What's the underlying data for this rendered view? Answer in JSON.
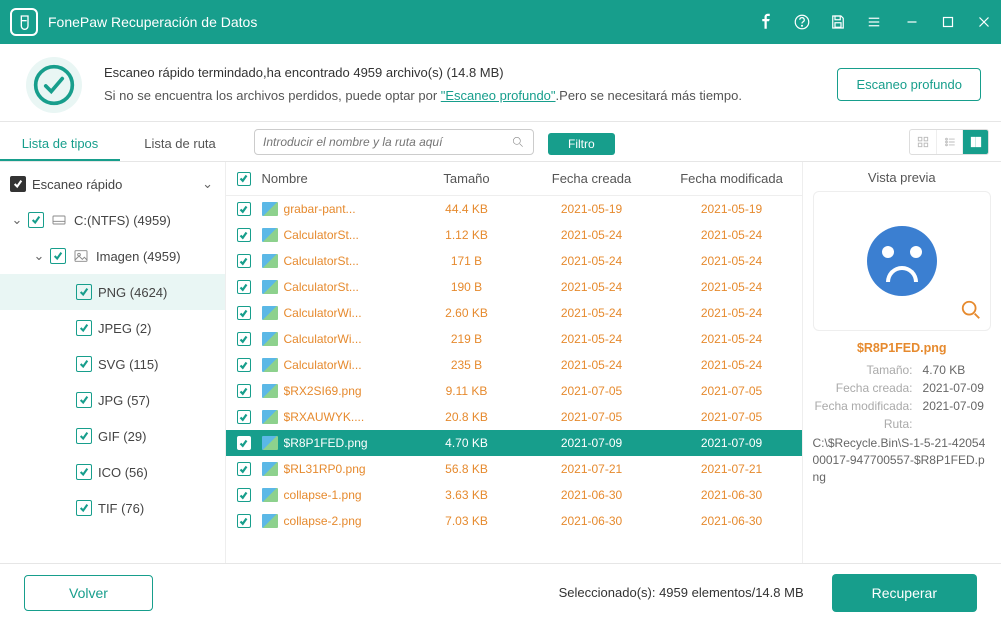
{
  "app": {
    "title": "FonePaw Recuperación de Datos"
  },
  "status": {
    "line1": "Escaneo rápido termindado,ha encontrado 4959 archivo(s) (14.8 MB)",
    "line2a": "Si no se encuentra los archivos perdidos, puede optar por ",
    "deep_link_label": "\"Escaneo profundo\"",
    "line2b": ".Pero se necesitará más tiempo.",
    "deep_btn": "Escaneo profundo"
  },
  "toolbar": {
    "tabs": {
      "types": "Lista de tipos",
      "paths": "Lista de ruta"
    },
    "search_placeholder": "Introducir el nombre y la ruta aquí",
    "filter_label": "Filtro"
  },
  "tree": {
    "header": "Escaneo rápido",
    "drive": "C:(NTFS) (4959)",
    "image_group": "Imagen (4959)",
    "types": [
      {
        "label": "PNG (4624)",
        "selected": true
      },
      {
        "label": "JPEG (2)"
      },
      {
        "label": "SVG (115)"
      },
      {
        "label": "JPG (57)"
      },
      {
        "label": "GIF (29)"
      },
      {
        "label": "ICO (56)"
      },
      {
        "label": "TIF (76)"
      }
    ]
  },
  "table": {
    "headers": {
      "name": "Nombre",
      "size": "Tamaño",
      "created": "Fecha creada",
      "modified": "Fecha modificada"
    },
    "rows": [
      {
        "name": "grabar-pant...",
        "size": "44.4 KB",
        "created": "2021-05-19",
        "modified": "2021-05-19"
      },
      {
        "name": "CalculatorSt...",
        "size": "1.12 KB",
        "created": "2021-05-24",
        "modified": "2021-05-24"
      },
      {
        "name": "CalculatorSt...",
        "size": "171  B",
        "created": "2021-05-24",
        "modified": "2021-05-24"
      },
      {
        "name": "CalculatorSt...",
        "size": "190  B",
        "created": "2021-05-24",
        "modified": "2021-05-24"
      },
      {
        "name": "CalculatorWi...",
        "size": "2.60 KB",
        "created": "2021-05-24",
        "modified": "2021-05-24"
      },
      {
        "name": "CalculatorWi...",
        "size": "219  B",
        "created": "2021-05-24",
        "modified": "2021-05-24"
      },
      {
        "name": "CalculatorWi...",
        "size": "235  B",
        "created": "2021-05-24",
        "modified": "2021-05-24"
      },
      {
        "name": "$RX2SI69.png",
        "size": "9.11 KB",
        "created": "2021-07-05",
        "modified": "2021-07-05"
      },
      {
        "name": "$RXAUWYK....",
        "size": "20.8 KB",
        "created": "2021-07-05",
        "modified": "2021-07-05"
      },
      {
        "name": "$R8P1FED.png",
        "size": "4.70 KB",
        "created": "2021-07-09",
        "modified": "2021-07-09",
        "selected": true
      },
      {
        "name": "$RL31RP0.png",
        "size": "56.8 KB",
        "created": "2021-07-21",
        "modified": "2021-07-21"
      },
      {
        "name": "collapse-1.png",
        "size": "3.63 KB",
        "created": "2021-06-30",
        "modified": "2021-06-30"
      },
      {
        "name": "collapse-2.png",
        "size": "7.03 KB",
        "created": "2021-06-30",
        "modified": "2021-06-30"
      }
    ]
  },
  "preview": {
    "title": "Vista previa",
    "filename": "$R8P1FED.png",
    "rows": {
      "size_k": "Tamaño:",
      "size_v": "4.70 KB",
      "created_k": "Fecha creada:",
      "created_v": "2021-07-09",
      "modified_k": "Fecha modificada:",
      "modified_v": "2021-07-09",
      "path_k": "Ruta:"
    },
    "path": "C:\\$Recycle.Bin\\S-1-5-21-4205400017-947700557-$R8P1FED.png"
  },
  "footer": {
    "back": "Volver",
    "selection": "Seleccionado(s): 4959 elementos/14.8 MB",
    "recover": "Recuperar"
  }
}
